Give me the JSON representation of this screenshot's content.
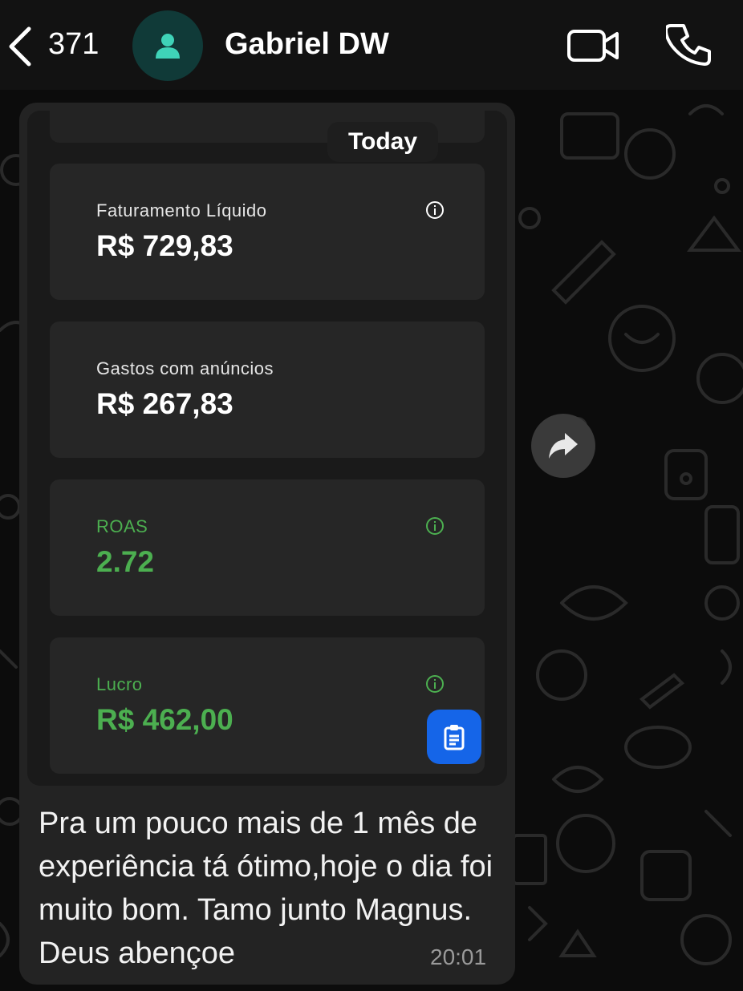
{
  "header": {
    "back_count": "371",
    "contact_name": "Gabriel DW"
  },
  "message": {
    "date_chip": "Today",
    "cards": [
      {
        "label": "Faturamento Líquido",
        "value": "R$ 729,83",
        "info": true,
        "color": "#ffffff"
      },
      {
        "label": "Gastos com anúncios",
        "value": "R$ 267,83",
        "info": false,
        "color": "#ffffff"
      },
      {
        "label": "ROAS",
        "value": "2.72",
        "info": true,
        "color": "#4caf50"
      },
      {
        "label": "Lucro",
        "value": "R$ 462,00",
        "info": true,
        "color": "#4caf50"
      }
    ],
    "text": "Pra um pouco mais de 1 mês de experiência tá ótimo,hoje o dia foi muito bom. Tamo junto Magnus. Deus abençoe",
    "time": "20:01"
  },
  "colors": {
    "accent_green": "#4caf50",
    "clip_button_blue": "#1565e8",
    "avatar_teal": "#103a38"
  },
  "icons": [
    "chevron-left-icon",
    "person-icon",
    "video-camera-icon",
    "phone-icon",
    "info-icon",
    "clipboard-icon",
    "forward-icon"
  ]
}
